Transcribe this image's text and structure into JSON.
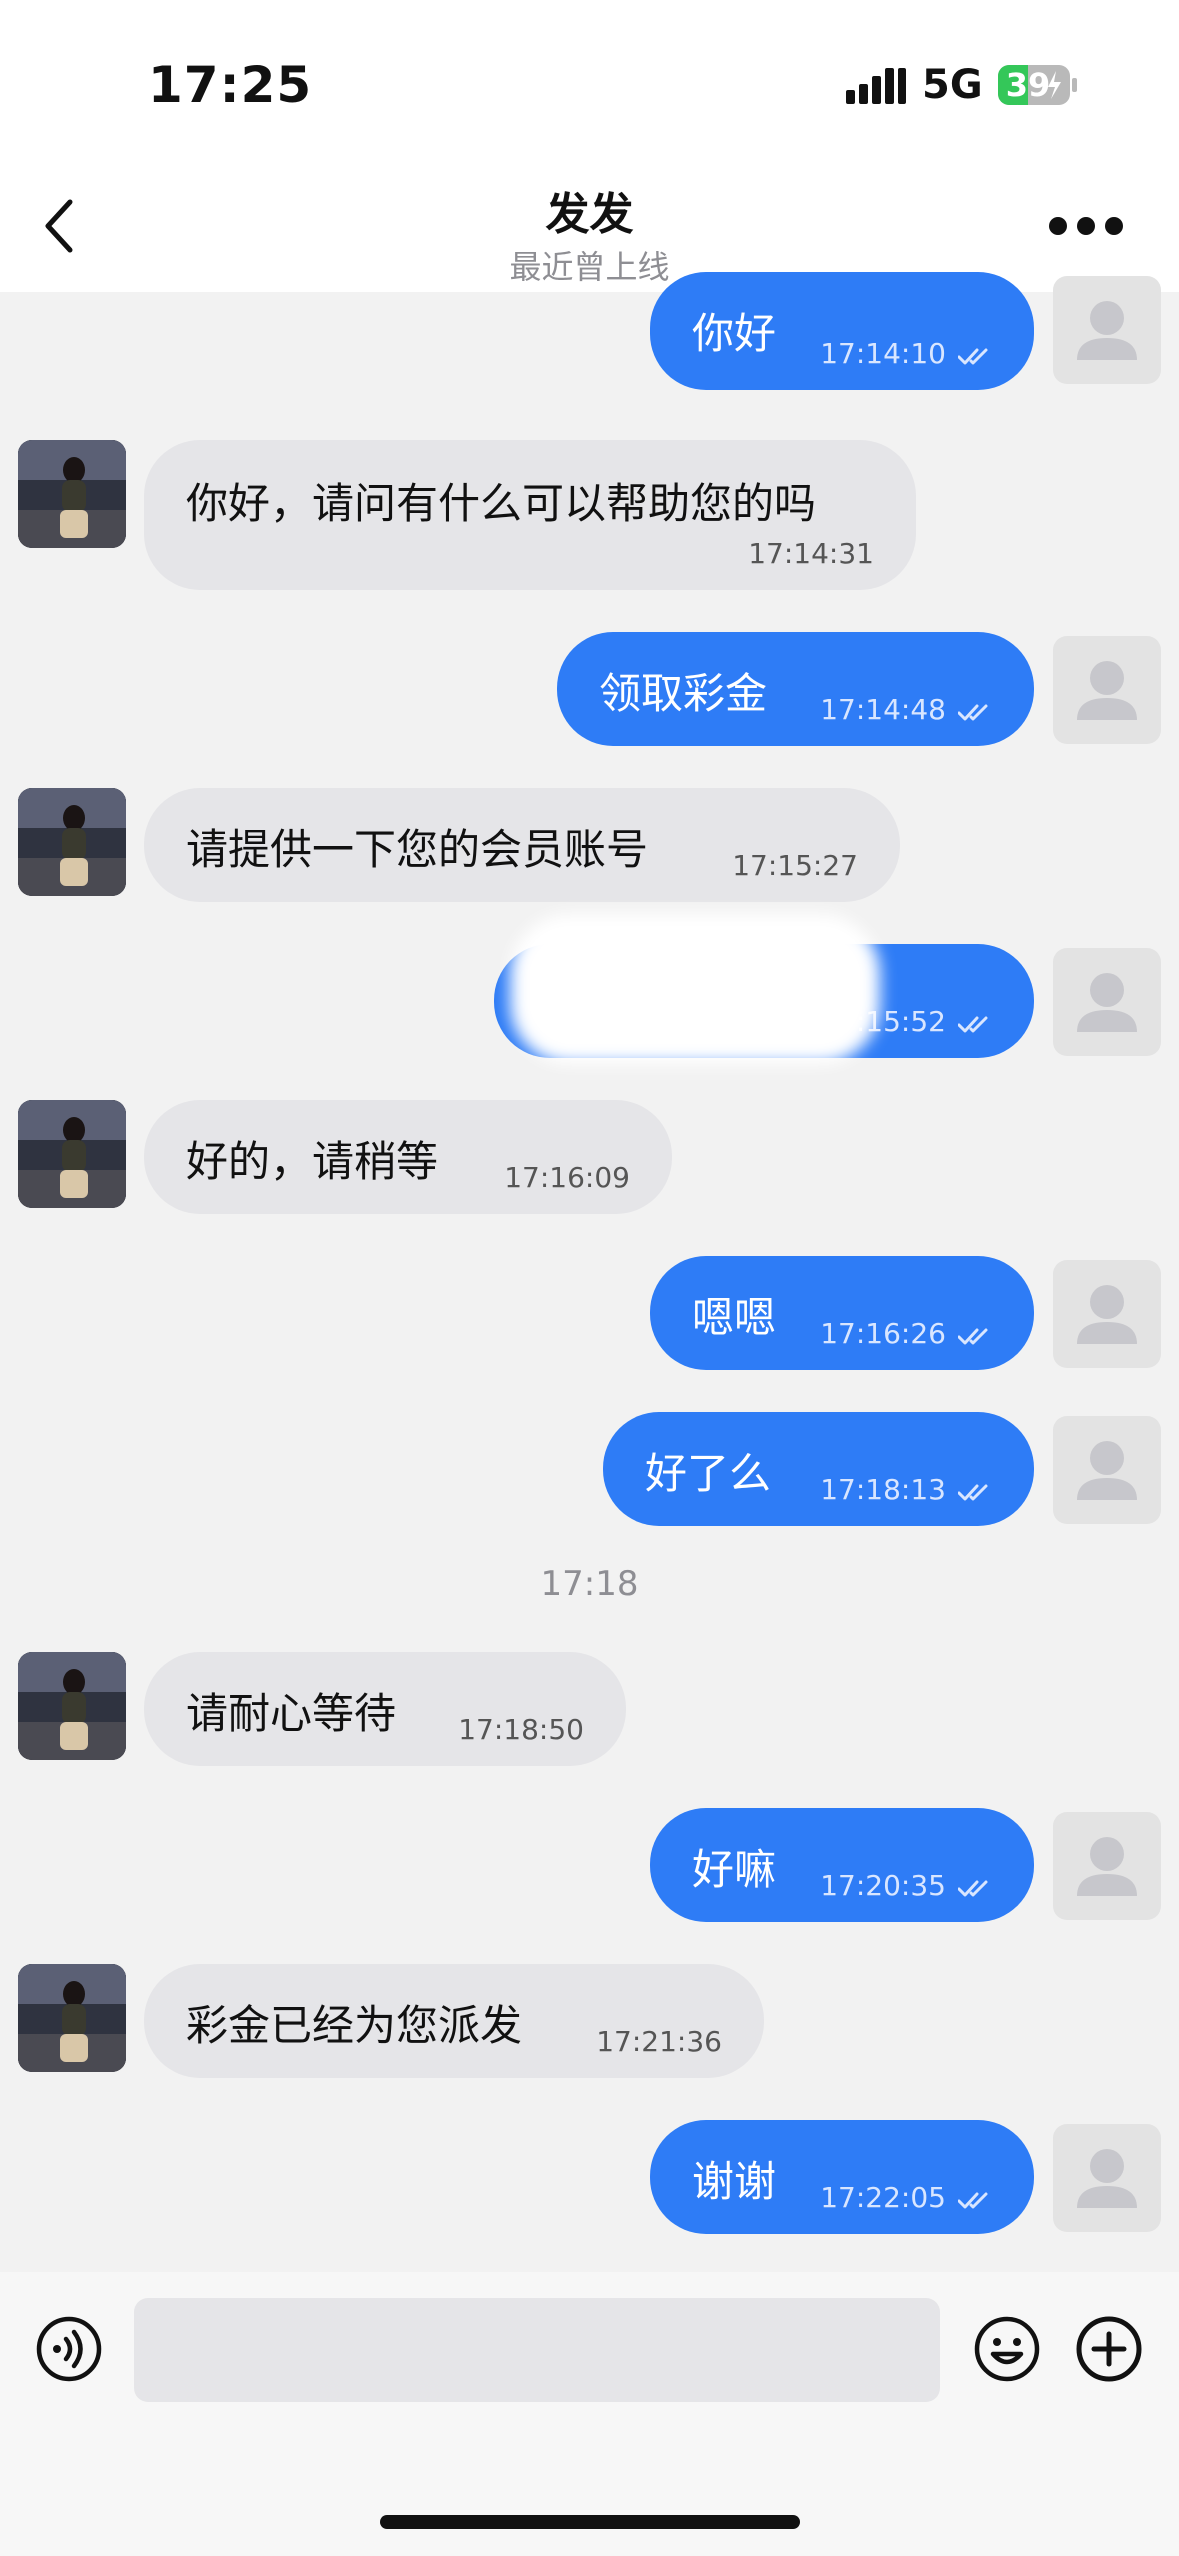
{
  "status": {
    "time": "17:25",
    "network": "5G",
    "battery": "39"
  },
  "header": {
    "title": "发发",
    "subtitle": "最近曾上线"
  },
  "messages": [
    {
      "dir": "out",
      "text": "你好",
      "time": "17:14:10"
    },
    {
      "dir": "in",
      "text": "你好，请问有什么可以帮助您的吗",
      "time": "17:14:31"
    },
    {
      "dir": "out",
      "text": "领取彩金",
      "time": "17:14:48"
    },
    {
      "dir": "in",
      "text": "请提供一下您的会员账号",
      "time": "17:15:27"
    },
    {
      "dir": "out",
      "text": "",
      "time": "17:15:52"
    },
    {
      "dir": "in",
      "text": "好的，请稍等",
      "time": "17:16:09"
    },
    {
      "dir": "out",
      "text": "嗯嗯",
      "time": "17:16:26"
    },
    {
      "dir": "out",
      "text": "好了么",
      "time": "17:18:13"
    },
    {
      "dir": "in",
      "text": "请耐心等待",
      "time": "17:18:50"
    },
    {
      "dir": "out",
      "text": "好嘛",
      "time": "17:20:35"
    },
    {
      "dir": "in",
      "text": "彩金已经为您派发",
      "time": "17:21:36"
    },
    {
      "dir": "out",
      "text": "谢谢",
      "time": "17:22:05"
    }
  ],
  "date_separator": "17:18",
  "input": {
    "placeholder": ""
  },
  "icons": [
    "back-icon",
    "more-icon",
    "voice-icon",
    "emoji-icon",
    "add-icon",
    "read-check-icon"
  ],
  "colors": {
    "outgoing": "#2e7cf6",
    "incoming": "#e5e5e8",
    "background": "#f2f2f2"
  }
}
